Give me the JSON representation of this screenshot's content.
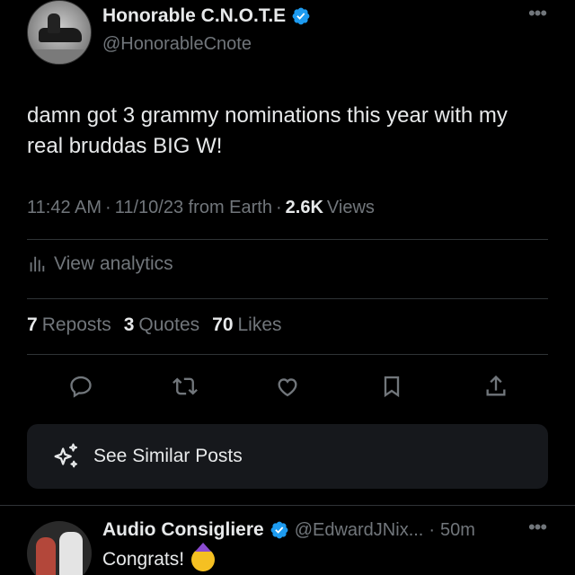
{
  "author": {
    "display_name": "Honorable C.N.O.T.E",
    "handle": "@HonorableCnote",
    "verified": true
  },
  "tweet": {
    "text": "damn got 3 grammy nominations this year with my real bruddas BIG W!",
    "time": "11:42 AM",
    "sep1": "·",
    "date": "11/10/23 from Earth",
    "sep2": "·",
    "views_count": "2.6K",
    "views_label": "Views"
  },
  "analytics": {
    "label": "View analytics",
    "icon": "bar-chart-icon"
  },
  "stats": [
    {
      "num": "7",
      "label": "Reposts"
    },
    {
      "num": "3",
      "label": "Quotes"
    },
    {
      "num": "70",
      "label": "Likes"
    }
  ],
  "actions": [
    "reply-icon",
    "repost-icon",
    "like-icon",
    "bookmark-icon",
    "share-icon"
  ],
  "similar": {
    "label": "See Similar Posts",
    "icon": "sparkle-icon"
  },
  "reply": {
    "display_name": "Audio Consigliere",
    "handle": "@EdwardJNix...",
    "sep": "·",
    "time": "50m",
    "text": "Congrats!",
    "emoji": "partying-face-emoji"
  },
  "colors": {
    "background": "#000000",
    "text": "#e7e9ea",
    "muted": "#71767b",
    "verified": "#1d9bf0",
    "card": "#16181c",
    "divider": "#2f3336"
  }
}
